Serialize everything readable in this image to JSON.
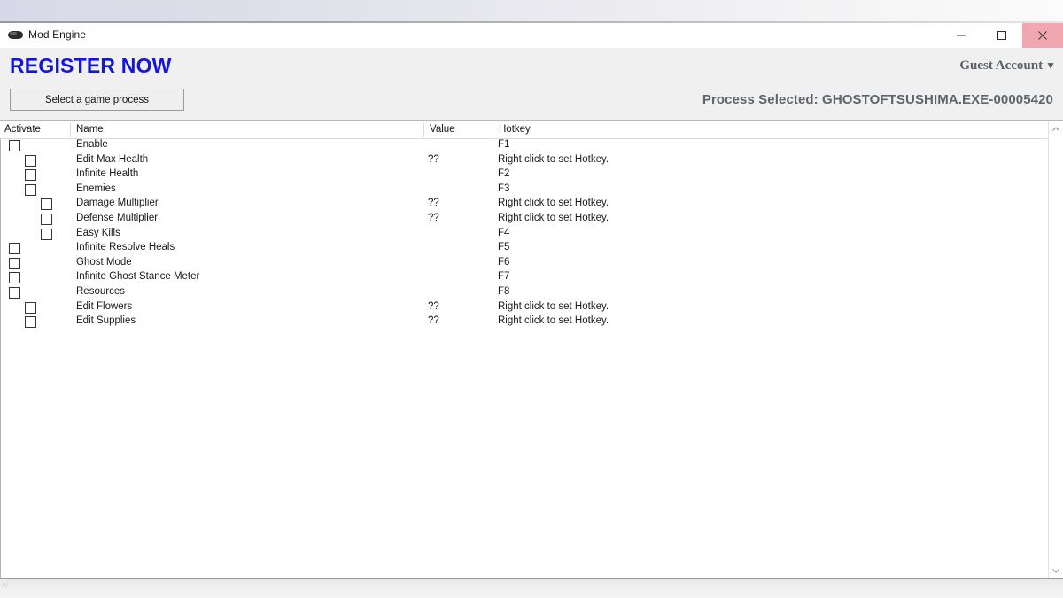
{
  "window": {
    "title": "Mod Engine",
    "icon": "gamepad-icon",
    "controls": {
      "minimize": "minimize-icon",
      "maximize": "maximize-icon",
      "close": "close-icon"
    },
    "close_button_color": "#f1a7b0"
  },
  "header": {
    "register_label": "REGISTER NOW",
    "register_color": "#1414e0",
    "account_label": "Guest Account",
    "account_caret": "▼"
  },
  "toolbar": {
    "select_process_label": "Select a game process",
    "process_selected_label": "Process Selected: GHOSTOFTSUSHIMA.EXE-00005420"
  },
  "table": {
    "columns": [
      "Activate",
      "Name",
      "Value",
      "Hotkey"
    ],
    "rows": [
      {
        "indent": 0,
        "name": "Enable",
        "value": "",
        "hotkey": "F1",
        "checked": false
      },
      {
        "indent": 1,
        "name": "Edit Max Health",
        "value": "??",
        "hotkey": "Right click to set Hotkey.",
        "checked": false
      },
      {
        "indent": 1,
        "name": "Infinite Health",
        "value": "",
        "hotkey": "F2",
        "checked": false
      },
      {
        "indent": 1,
        "name": "Enemies",
        "value": "",
        "hotkey": "F3",
        "checked": false
      },
      {
        "indent": 2,
        "name": "Damage Multiplier",
        "value": "??",
        "hotkey": "Right click to set Hotkey.",
        "checked": false
      },
      {
        "indent": 2,
        "name": "Defense Multiplier",
        "value": "??",
        "hotkey": "Right click to set Hotkey.",
        "checked": false
      },
      {
        "indent": 2,
        "name": "Easy Kills",
        "value": "",
        "hotkey": "F4",
        "checked": false
      },
      {
        "indent": 0,
        "name": "Infinite Resolve Heals",
        "value": "",
        "hotkey": "F5",
        "checked": false
      },
      {
        "indent": 0,
        "name": "Ghost Mode",
        "value": "",
        "hotkey": "F6",
        "checked": false
      },
      {
        "indent": 0,
        "name": "Infinite Ghost Stance Meter",
        "value": "",
        "hotkey": "F7",
        "checked": false
      },
      {
        "indent": 0,
        "name": "Resources",
        "value": "",
        "hotkey": "F8",
        "checked": false
      },
      {
        "indent": 1,
        "name": "Edit Flowers",
        "value": "??",
        "hotkey": "Right click to set Hotkey.",
        "checked": false
      },
      {
        "indent": 1,
        "name": "Edit Supplies",
        "value": "??",
        "hotkey": "Right click to set Hotkey.",
        "checked": false
      }
    ]
  },
  "scrollbar": {
    "up_icon": "chevron-up-icon",
    "down_icon": "chevron-down-icon"
  },
  "status_bar": {
    "grip": "resize-grip-icon"
  }
}
